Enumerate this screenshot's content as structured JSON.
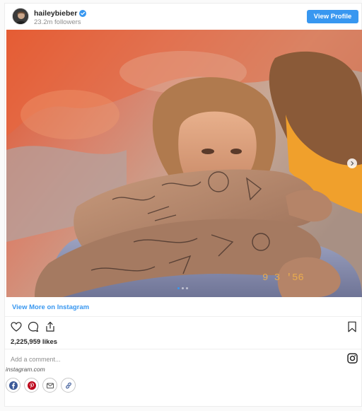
{
  "profile": {
    "username": "haileybieber",
    "verified": true,
    "followers": "23.2m followers",
    "view_profile_label": "View Profile"
  },
  "post": {
    "image_alt": "Photo of a couple embracing, tattooed arms wrapped around a woman, warm sunlit tones",
    "timestamp_overlay": "9 3 '56",
    "carousel": {
      "total": 3,
      "current": 1
    },
    "view_more_label": "View More on Instagram",
    "likes": "2,225,959 likes",
    "comment_placeholder": "Add a comment...",
    "source": "instagram.com"
  },
  "icons": {
    "avatar": "avatar-icon",
    "verified": "verified-badge-icon",
    "next": "chevron-right-icon",
    "like": "heart-icon",
    "comment": "comment-icon",
    "share": "share-icon",
    "save": "bookmark-icon",
    "instagram": "instagram-icon",
    "social": [
      "facebook-icon",
      "pinterest-icon",
      "email-icon",
      "link-icon"
    ]
  },
  "colors": {
    "accent": "#3897f0",
    "facebook": "#3b5998",
    "pinterest": "#bd081c",
    "neutral": "#555555"
  }
}
